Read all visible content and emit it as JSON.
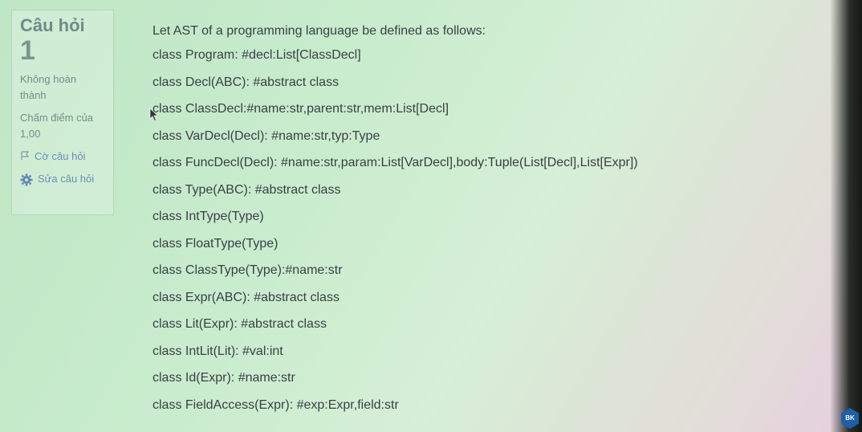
{
  "sidebar": {
    "title": "Câu hỏi",
    "number": "1",
    "state": "Không hoàn thành",
    "mark": "Chấm điểm của 1,00",
    "flag_label": "Cờ câu hỏi",
    "edit_label": "Sửa câu hỏi"
  },
  "question": {
    "intro": "Let AST of a programming language be defined as follows:",
    "lines": [
      "class Program: #decl:List[ClassDecl]",
      "class Decl(ABC): #abstract class",
      "class ClassDecl:#name:str,parent:str,mem:List[Decl]",
      "class VarDecl(Decl): #name:str,typ:Type",
      "class FuncDecl(Decl): #name:str,param:List[VarDecl],body:Tuple(List[Decl],List[Expr])",
      "class Type(ABC): #abstract class",
      "class IntType(Type)",
      "class FloatType(Type)",
      "class ClassType(Type):#name:str",
      "class Expr(ABC): #abstract class",
      "class Lit(Expr): #abstract class",
      "class IntLit(Lit): #val:int",
      "class Id(Expr): #name:str",
      "class FieldAccess(Expr): #exp:Expr,field:str"
    ]
  },
  "logo": {
    "text": "BK"
  },
  "colors": {
    "accent_link": "#6a8fb5",
    "logo": "#1f5fa8"
  }
}
